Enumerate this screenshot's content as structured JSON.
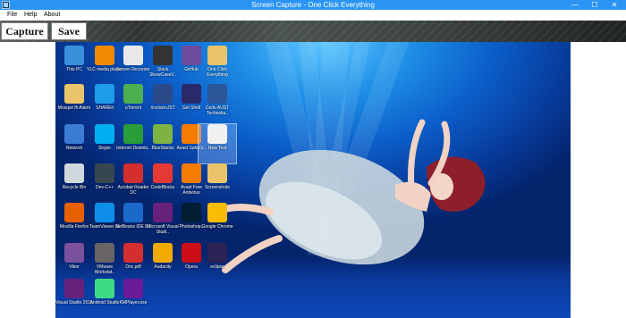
{
  "window": {
    "title": "Screen Capture - One Click Everything",
    "minimize": "—",
    "maximize": "☐",
    "close": "✕"
  },
  "menu": [
    "File",
    "Help",
    "About"
  ],
  "toolbar": {
    "capture_label": "Capture",
    "save_label": "Save"
  },
  "desktop_icons": [
    {
      "label": "This PC",
      "icon": "computer-icon",
      "color": "#3a8fd9"
    },
    {
      "label": "VLC media player",
      "icon": "vlc-icon",
      "color": "#f08a00"
    },
    {
      "label": "Screen Recorder",
      "icon": "screen-recorder-icon",
      "color": "#e8e8e8"
    },
    {
      "label": "Slack ShowCaseV..",
      "icon": "slack-showcase-icon",
      "color": "#333333"
    },
    {
      "label": "GitHub",
      "icon": "github-icon",
      "color": "#6e4c9e"
    },
    {
      "label": "One Click Everything",
      "icon": "folder-icon",
      "color": "#e9c46a"
    },
    {
      "label": "Mosqwi Ifi Alarm",
      "icon": "folder-icon",
      "color": "#e9c46a"
    },
    {
      "label": "SHAREit",
      "icon": "shareit-icon",
      "color": "#1e9be9"
    },
    {
      "label": "uTorrent",
      "icon": "utorrent-icon",
      "color": "#4caf50"
    },
    {
      "label": "XcelsionJST",
      "icon": "xcelsion-icon",
      "color": "#2b4a8a"
    },
    {
      "label": "Get Shell",
      "icon": "terminal-icon",
      "color": "#2a2a6a"
    },
    {
      "label": "Cedu AUST Technolia..",
      "icon": "word-icon",
      "color": "#2b579a"
    },
    {
      "label": "Network",
      "icon": "network-icon",
      "color": "#3a7bd5"
    },
    {
      "label": "Skype",
      "icon": "skype-icon",
      "color": "#00aff0"
    },
    {
      "label": "Internet Downlo..",
      "icon": "idm-icon",
      "color": "#2a9d3a"
    },
    {
      "label": "BlueStacks",
      "icon": "bluestacks-icon",
      "color": "#7cb342"
    },
    {
      "label": "Avast SafeZo..",
      "icon": "avast-icon",
      "color": "#f57c00"
    },
    {
      "label": "New Text",
      "icon": "text-file-icon",
      "color": "#f0f0f0"
    },
    {
      "label": "Recycle Bin",
      "icon": "recycle-bin-icon",
      "color": "#cfd8dc"
    },
    {
      "label": "Dev-C++",
      "icon": "devcpp-icon",
      "color": "#37474f"
    },
    {
      "label": "Acrobat Reader DC",
      "icon": "acrobat-icon",
      "color": "#d32f2f"
    },
    {
      "label": "CodeBlocks",
      "icon": "codeblocks-icon",
      "color": "#e53935"
    },
    {
      "label": "Avast Free Antivirus",
      "icon": "avast-icon",
      "color": "#f57c00"
    },
    {
      "label": "Screenshots",
      "icon": "folder-icon",
      "color": "#e9c46a"
    },
    {
      "label": "Mozilla Firefox",
      "icon": "firefox-icon",
      "color": "#e66000"
    },
    {
      "label": "TeamViewer 11",
      "icon": "teamviewer-icon",
      "color": "#0e8ee9"
    },
    {
      "label": "NetBeans IDE 8.1",
      "icon": "netbeans-icon",
      "color": "#1b6ac9"
    },
    {
      "label": "Microsoft Visual Studi..",
      "icon": "visual-studio-icon",
      "color": "#68217a"
    },
    {
      "label": "Photoshop..",
      "icon": "photoshop-icon",
      "color": "#001d34"
    },
    {
      "label": "Google Chrome",
      "icon": "chrome-icon",
      "color": "#fbbc05"
    },
    {
      "label": "Viber",
      "icon": "viber-icon",
      "color": "#7b519d"
    },
    {
      "label": "VMware Workstat..",
      "icon": "vmware-icon",
      "color": "#696566"
    },
    {
      "label": "Doc.pdf",
      "icon": "pdf-icon",
      "color": "#d32f2f"
    },
    {
      "label": "Audacity",
      "icon": "audacity-icon",
      "color": "#f2a900"
    },
    {
      "label": "Opera",
      "icon": "opera-icon",
      "color": "#cc0f16"
    },
    {
      "label": "eclipse",
      "icon": "eclipse-icon",
      "color": "#2c2255"
    },
    {
      "label": "Visual Studio 2015",
      "icon": "visual-studio-icon",
      "color": "#68217a"
    },
    {
      "label": "Android Studio",
      "icon": "android-studio-icon",
      "color": "#3ddc84"
    },
    {
      "label": "KMPlayer.exe",
      "icon": "kmplayer-icon",
      "color": "#6a1b9a"
    }
  ]
}
